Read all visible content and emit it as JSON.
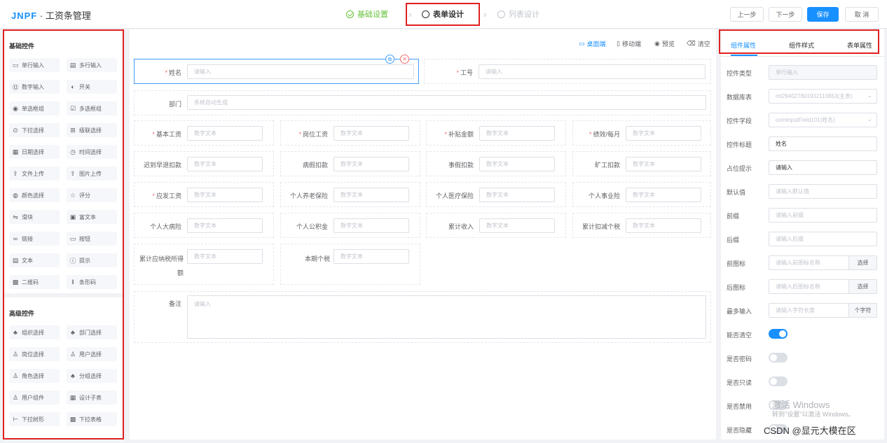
{
  "app": {
    "brand": "JNPF",
    "separator": "·",
    "title": "工资条管理"
  },
  "steps": [
    {
      "label": "基础设置",
      "state": "done"
    },
    {
      "label": "表单设计",
      "state": "active"
    },
    {
      "label": "列表设计",
      "state": "pending"
    }
  ],
  "toolbar": {
    "prev": "上一步",
    "next": "下一步",
    "save": "保存",
    "cancel": "取 消"
  },
  "left": {
    "basic_title": "基础控件",
    "basic": [
      {
        "icon": "▭",
        "label": "单行输入"
      },
      {
        "icon": "▤",
        "label": "多行输入"
      },
      {
        "icon": "⑫",
        "label": "数字输入"
      },
      {
        "icon": "◐",
        "label": "开关"
      },
      {
        "icon": "◉",
        "label": "单选框组"
      },
      {
        "icon": "☑",
        "label": "多选框组"
      },
      {
        "icon": "⊙",
        "label": "下拉选择"
      },
      {
        "icon": "⊞",
        "label": "级联选择"
      },
      {
        "icon": "▦",
        "label": "日期选择"
      },
      {
        "icon": "◷",
        "label": "时间选择"
      },
      {
        "icon": "⇪",
        "label": "文件上传"
      },
      {
        "icon": "⇪",
        "label": "图片上传"
      },
      {
        "icon": "◍",
        "label": "颜色选择"
      },
      {
        "icon": "☆",
        "label": "评分"
      },
      {
        "icon": "⇋",
        "label": "滑块"
      },
      {
        "icon": "▣",
        "label": "富文本"
      },
      {
        "icon": "∞",
        "label": "链接"
      },
      {
        "icon": "▭",
        "label": "按钮"
      },
      {
        "icon": "▤",
        "label": "文本"
      },
      {
        "icon": "ⓘ",
        "label": "提示"
      },
      {
        "icon": "▩",
        "label": "二维码"
      },
      {
        "icon": "‖",
        "label": "条形码"
      }
    ],
    "advanced_title": "高级控件",
    "advanced": [
      {
        "icon": "♣",
        "label": "组织选择"
      },
      {
        "icon": "♣",
        "label": "部门选择"
      },
      {
        "icon": "♙",
        "label": "岗位选择"
      },
      {
        "icon": "♙",
        "label": "用户选择"
      },
      {
        "icon": "♙",
        "label": "角色选择"
      },
      {
        "icon": "♣",
        "label": "分组选择"
      },
      {
        "icon": "♙",
        "label": "用户组件"
      },
      {
        "icon": "▦",
        "label": "设计子表"
      },
      {
        "icon": "⊢",
        "label": "下拉树形"
      },
      {
        "icon": "▩",
        "label": "下拉表格"
      }
    ]
  },
  "canvas_tools": {
    "desktop": "桌面端",
    "mobile": "移动端",
    "preview": "预览",
    "clear": "清空"
  },
  "form": {
    "name": {
      "label": "姓名",
      "placeholder": "请输入"
    },
    "job_no": {
      "label": "工号",
      "placeholder": "请输入"
    },
    "dept": {
      "label": "部门",
      "placeholder": "系统自动生成"
    },
    "number_placeholder": "数字文本",
    "num_fields": [
      {
        "label": "基本工资",
        "required": true
      },
      {
        "label": "岗位工资",
        "required": true
      },
      {
        "label": "补贴金额",
        "required": true
      },
      {
        "label": "绩效/每月",
        "required": true
      },
      {
        "label": "迟到早退扣款",
        "required": false
      },
      {
        "label": "病假扣款",
        "required": false
      },
      {
        "label": "事假扣款",
        "required": false
      },
      {
        "label": "旷工扣款",
        "required": false
      },
      {
        "label": "应发工资",
        "required": true
      },
      {
        "label": "个人养老保险",
        "required": false
      },
      {
        "label": "个人医疗保险",
        "required": false
      },
      {
        "label": "个人事业险",
        "required": false
      },
      {
        "label": "个人大病险",
        "required": false
      },
      {
        "label": "个人公积金",
        "required": false
      },
      {
        "label": "累计收入",
        "required": false
      },
      {
        "label": "累计扣减个税",
        "required": false
      },
      {
        "label": "累计应纳税所得额",
        "required": false
      },
      {
        "label": "本期个税",
        "required": false
      }
    ],
    "remark": {
      "label": "备注",
      "placeholder": "请输入"
    },
    "required_mark": "*"
  },
  "right": {
    "tabs": [
      "组件属性",
      "组件样式",
      "表单属性"
    ],
    "rows": [
      {
        "label": "控件类型",
        "kind": "input",
        "value": "单行输入",
        "disabled": true
      },
      {
        "label": "数据库表",
        "kind": "select",
        "value": "mt294027801932110853(主表)"
      },
      {
        "label": "控件字段",
        "kind": "select",
        "value": "comInputField101(姓名)"
      },
      {
        "label": "控件标题",
        "kind": "input",
        "value": "姓名",
        "filled": true
      },
      {
        "label": "占位提示",
        "kind": "input",
        "value": "请输入",
        "filled": true
      },
      {
        "label": "默认值",
        "kind": "input",
        "value": "请输入默认值"
      },
      {
        "label": "前缀",
        "kind": "input",
        "value": "请输入前缀"
      },
      {
        "label": "后缀",
        "kind": "input",
        "value": "请输入后缀"
      },
      {
        "label": "前图标",
        "kind": "append",
        "value": "请输入前图标名称",
        "append": "选择"
      },
      {
        "label": "后图标",
        "kind": "append",
        "value": "请输入后图标名称",
        "append": "选择"
      },
      {
        "label": "最多输入",
        "kind": "append",
        "value": "请输入字符长度",
        "append": "个字符"
      },
      {
        "label": "能否清空",
        "kind": "switch",
        "on": true
      },
      {
        "label": "是否密码",
        "kind": "switch",
        "on": false
      },
      {
        "label": "是否只读",
        "kind": "switch",
        "on": false
      },
      {
        "label": "是否禁用",
        "kind": "switch",
        "on": false
      },
      {
        "label": "是否隐藏",
        "kind": "switch",
        "on": false
      }
    ]
  },
  "overlay": {
    "activate": "激活 Windows",
    "activate_hint": "转到\"设置\"以激活 Windows。",
    "watermark": "CSDN @显元大模在区"
  },
  "colors": {
    "accent": "#1890ff",
    "success": "#67c23a",
    "required": "#f56c6c",
    "highlight": "#e02020"
  }
}
